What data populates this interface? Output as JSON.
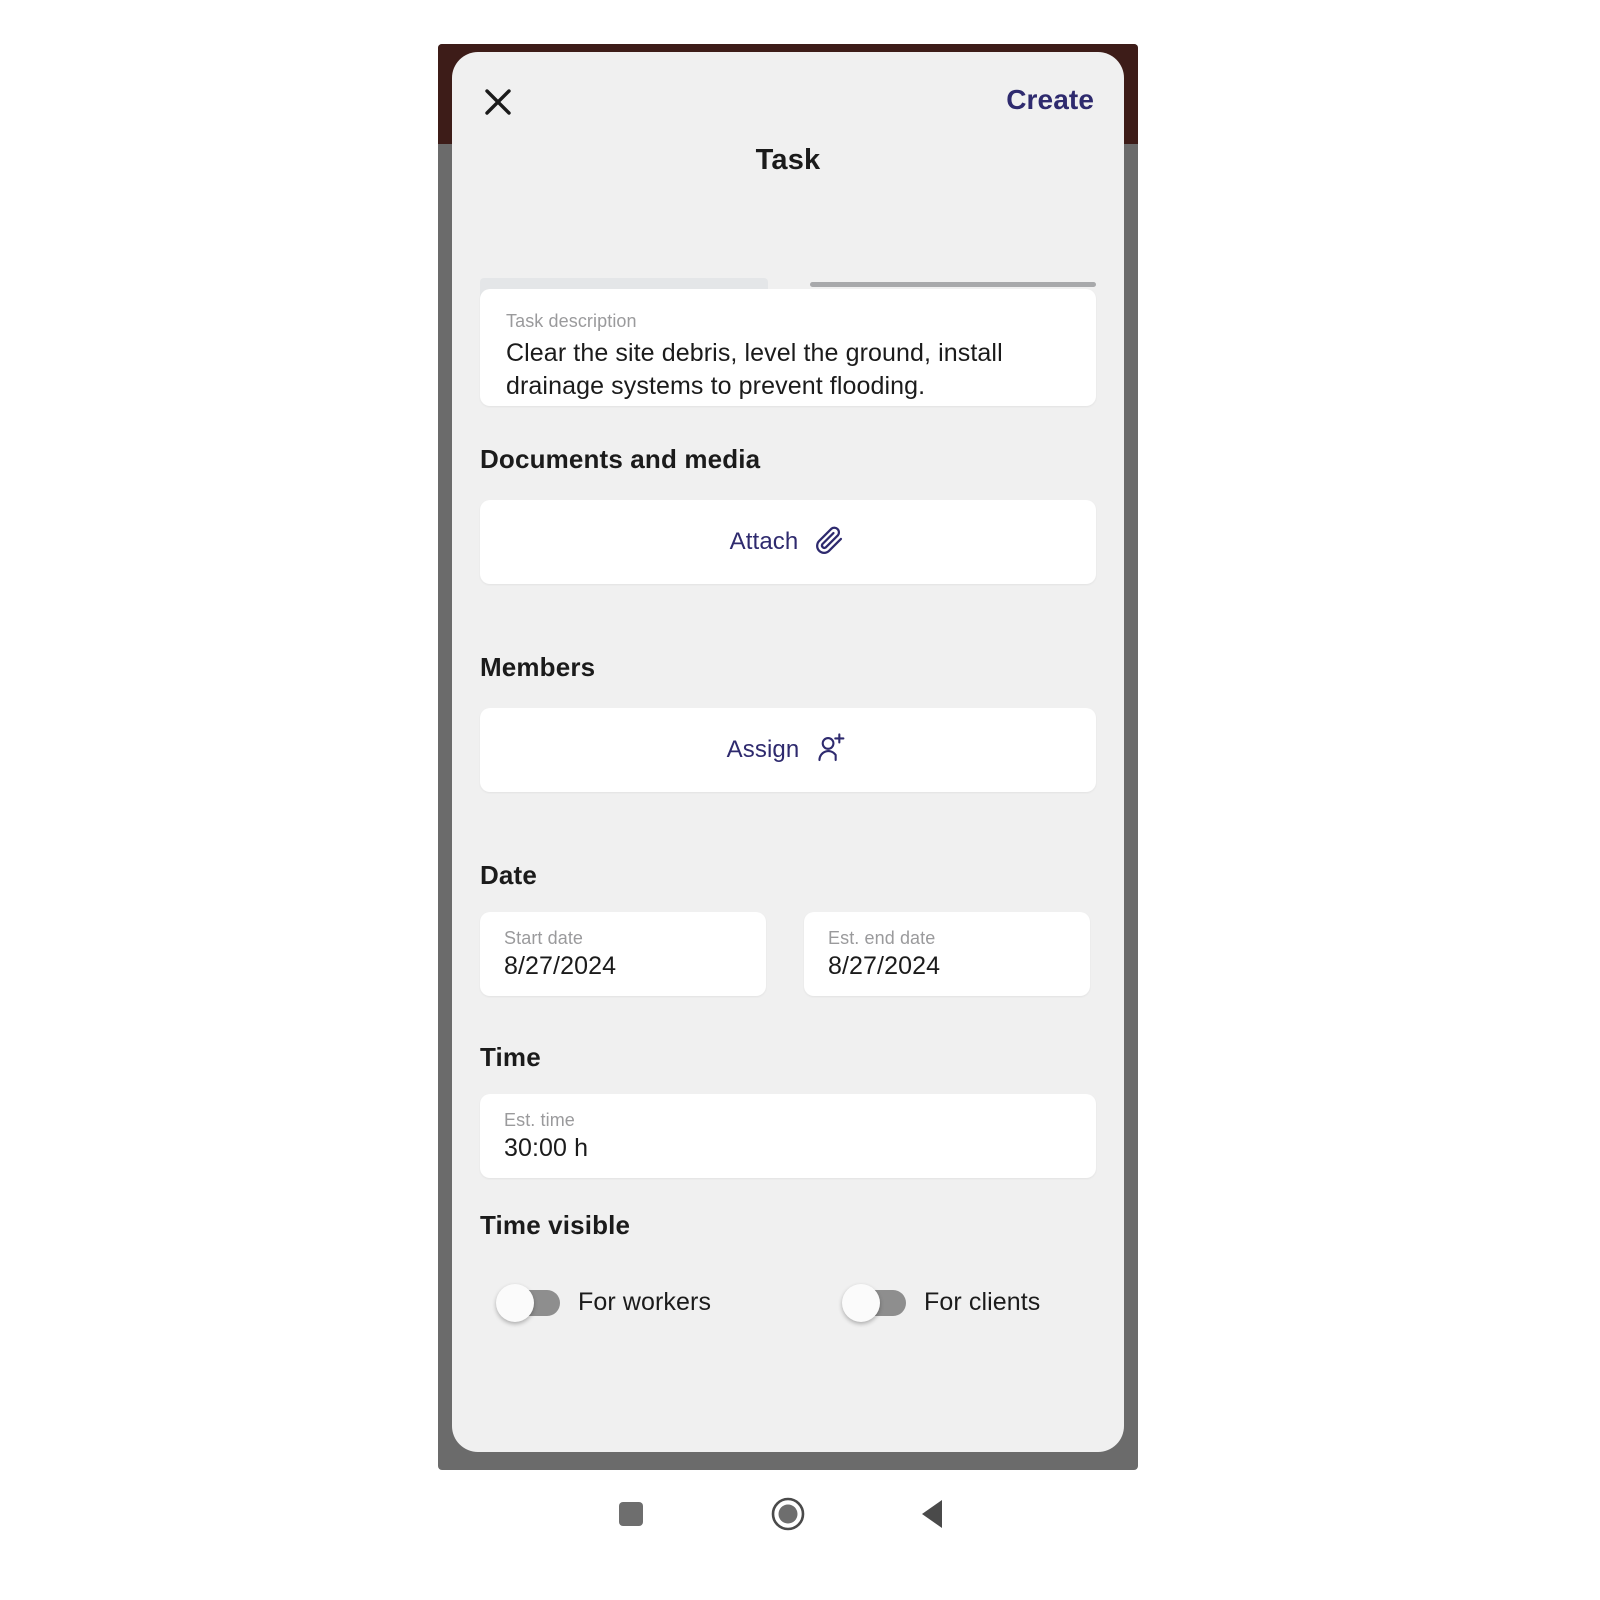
{
  "device": {
    "frame_top_color": "#3d1c18",
    "frame_color": "#6b6b6b"
  },
  "screen": {
    "background_color": "#f0f0f0",
    "accent_color": "#2e2a6e"
  },
  "topbar": {
    "close_icon": "close-icon",
    "create_label": "Create"
  },
  "header": {
    "title": "Task"
  },
  "description": {
    "label": "Task description",
    "value": "Clear the site debris, level the ground, install drainage systems to prevent flooding."
  },
  "documents": {
    "heading": "Documents and media",
    "attach_label": "Attach",
    "attach_icon": "paperclip-icon"
  },
  "members": {
    "heading": "Members",
    "assign_label": "Assign",
    "assign_icon": "person-add-icon"
  },
  "date": {
    "heading": "Date",
    "start": {
      "label": "Start date",
      "value": "8/27/2024"
    },
    "end": {
      "label": "Est. end date",
      "value": "8/27/2024"
    }
  },
  "time": {
    "heading": "Time",
    "estimate": {
      "label": "Est. time",
      "value": "30:00 h"
    }
  },
  "time_visible": {
    "heading": "Time visible",
    "toggles": [
      {
        "label": "For workers",
        "state": "off"
      },
      {
        "label": "For clients",
        "state": "off"
      }
    ]
  },
  "nav_bar": {
    "recents_icon": "square-recents-icon",
    "home_icon": "circle-home-icon",
    "back_icon": "triangle-back-icon"
  }
}
